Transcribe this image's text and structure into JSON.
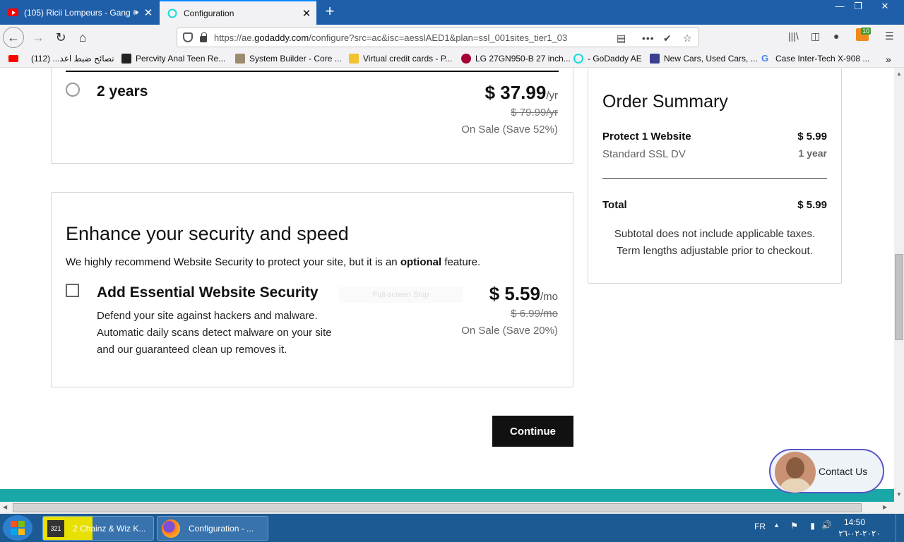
{
  "browser": {
    "tabs": [
      {
        "title": "(105) Ricii Lompeurs - Gang",
        "favicon": "youtube-icon"
      },
      {
        "title": "Configuration",
        "favicon": "godaddy-icon"
      }
    ],
    "url_prefix": "https://ae.",
    "url_domain": "godaddy.com",
    "url_rest": "/configure?src=ac&isc=aesslAED1&plan=ssl_001sites_tier1_03",
    "extension_badge": "10",
    "bookmarks": [
      {
        "label": "نصائح ضبط اعد... (112)",
        "icon": "youtube-icon"
      },
      {
        "label": "Percvity Anal Teen Re...",
        "icon": "yp-icon"
      },
      {
        "label": "System Builder - Core ...",
        "icon": "box-icon"
      },
      {
        "label": "Virtual credit cards - P...",
        "icon": "card-icon"
      },
      {
        "label": "LG 27GN950-B 27 inch...",
        "icon": "lg-icon"
      },
      {
        "label": "- GoDaddy AE",
        "icon": "godaddy-icon"
      },
      {
        "label": "New Cars, Used Cars, ...",
        "icon": "car-icon"
      },
      {
        "label": "Case Inter-Tech X-908 ...",
        "icon": "google-icon"
      }
    ]
  },
  "term_option": {
    "label": "2 years",
    "price": "$ 37.99",
    "unit": "/yr",
    "original": "$ 79.99/yr",
    "sale": "On Sale (Save 52%)"
  },
  "security": {
    "title": "Enhance your security and speed",
    "desc_pre": "We highly recommend Website Security to protect your site, but it is an ",
    "desc_bold": "optional",
    "desc_post": " feature.",
    "option_label": "Add Essential Website Security",
    "desc_lines": [
      "Defend your site against hackers and malware.",
      "Automatic daily scans detect malware on your site",
      "and our guaranteed clean up removes it."
    ],
    "price": "$ 5.59",
    "unit": "/mo",
    "original": "$ 6.99/mo",
    "sale": "On Sale (Save 20%)",
    "snip_overlay": "Full-screen Snip"
  },
  "continue_label": "Continue",
  "summary": {
    "title": "Order Summary",
    "item_name": "Protect 1 Website",
    "item_price": "$ 5.99",
    "item_sub": "Standard SSL DV",
    "item_term": "1 year",
    "total_label": "Total",
    "total_value": "$ 5.99",
    "note1": "Subtotal does not include applicable taxes.",
    "note2": "Term lengths adjustable prior to checkout."
  },
  "contact_label": "Contact Us",
  "taskbar": {
    "items": [
      {
        "label": "2 Chainz & Wiz K..."
      },
      {
        "label": "Configuration - ..."
      }
    ],
    "lang": "FR",
    "time": "14:50",
    "date": "٢٠٢٠-٠٢-٢٦"
  }
}
